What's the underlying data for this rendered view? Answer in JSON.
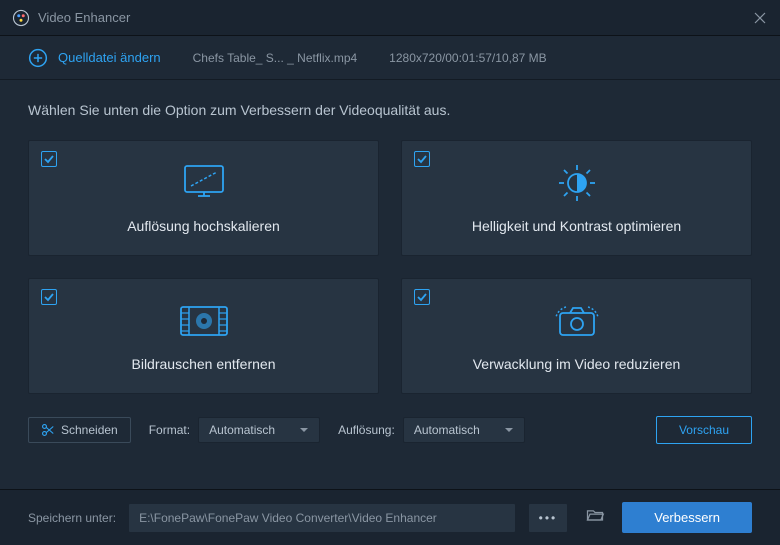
{
  "titlebar": {
    "title": "Video Enhancer"
  },
  "filebar": {
    "change_source": "Quelldatei ändern",
    "filename": "Chefs Table_ S... _ Netflix.mp4",
    "fileinfo": "1280x720/00:01:57/10,87 MB"
  },
  "instruction": "Wählen Sie unten die Option zum Verbessern der Videoqualität aus.",
  "options": {
    "upscale": "Auflösung hochskalieren",
    "brightness": "Helligkeit und Kontrast optimieren",
    "noise": "Bildrauschen entfernen",
    "shake": "Verwacklung im Video reduzieren"
  },
  "controls": {
    "cut": "Schneiden",
    "format_label": "Format:",
    "format_value": "Automatisch",
    "resolution_label": "Auflösung:",
    "resolution_value": "Automatisch",
    "preview": "Vorschau"
  },
  "bottom": {
    "save_label": "Speichern unter:",
    "path": "E:\\FonePaw\\FonePaw Video Converter\\Video Enhancer",
    "enhance": "Verbessern"
  }
}
